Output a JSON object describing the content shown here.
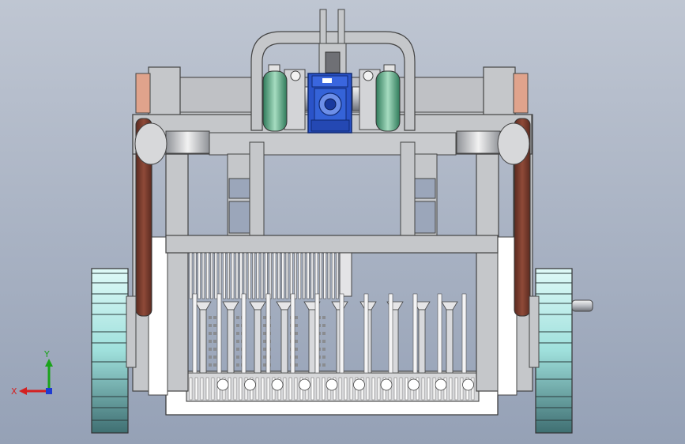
{
  "triad": {
    "x_label": "X",
    "y_label": "Y"
  },
  "colors": {
    "background_top": "#bfc6d2",
    "background_bottom": "#95a1b6",
    "frame_gray": "#c5c7ca",
    "frame_edge": "#4a4a4a",
    "motor_blue": "#2a53c9",
    "pulley_green": "#3f9a73",
    "belt_brown": "#7a3a2c",
    "copper_plate": "#e0a38c",
    "wheel_cyan": "#bff1ee",
    "white_plate": "#ffffff",
    "axis_x": "#d42020",
    "axis_y": "#1aa31a",
    "axis_z": "#1f3bd1"
  }
}
